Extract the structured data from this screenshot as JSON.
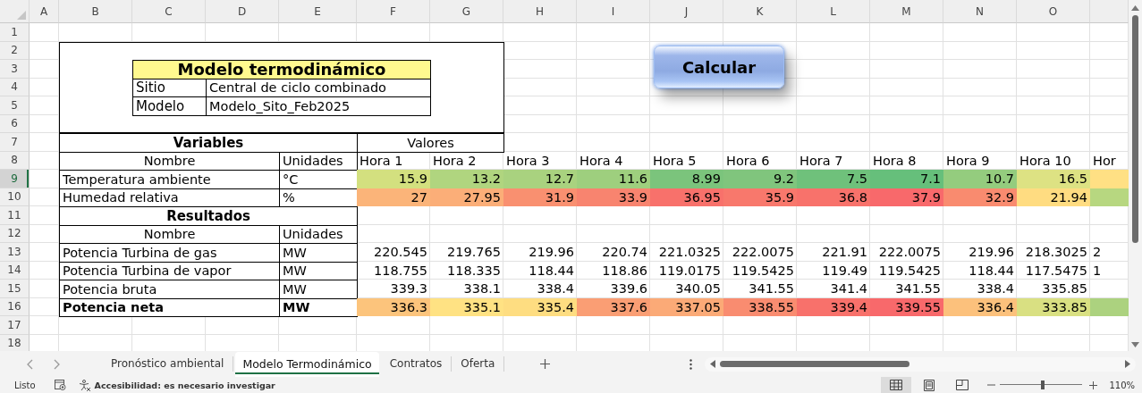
{
  "column_headers": [
    "A",
    "B",
    "C",
    "D",
    "E",
    "F",
    "G",
    "H",
    "I",
    "J",
    "K",
    "L",
    "M",
    "N",
    "O"
  ],
  "row_headers": [
    {
      "label": "1",
      "selected": false
    },
    {
      "label": "2",
      "selected": false
    },
    {
      "label": "3",
      "selected": false
    },
    {
      "label": "4",
      "selected": false
    },
    {
      "label": "5",
      "selected": false
    },
    {
      "label": "6",
      "selected": false
    },
    {
      "label": "7",
      "selected": false
    },
    {
      "label": "8",
      "selected": false
    },
    {
      "label": "9",
      "selected": true
    },
    {
      "label": "10",
      "selected": false
    },
    {
      "label": "11",
      "selected": false
    },
    {
      "label": "12",
      "selected": false
    },
    {
      "label": "13",
      "selected": false
    },
    {
      "label": "14",
      "selected": false
    },
    {
      "label": "15",
      "selected": false
    },
    {
      "label": "16",
      "selected": false
    },
    {
      "label": "17",
      "selected": false
    },
    {
      "label": "18",
      "selected": false
    }
  ],
  "info_box": {
    "title": "Modelo termodinámico",
    "fields": [
      {
        "label": "Sitio",
        "value": "Central de ciclo combinado"
      },
      {
        "label": "Modelo",
        "value": "Modelo_Sito_Feb2025"
      }
    ]
  },
  "button": {
    "label": "Calcular"
  },
  "variables": {
    "heading": "Variables",
    "values_heading": "Valores",
    "name_heading": "Nombre",
    "units_heading": "Unidades",
    "hours": [
      "Hora 1",
      "Hora 2",
      "Hora 3",
      "Hora 4",
      "Hora 5",
      "Hora 6",
      "Hora 7",
      "Hora 8",
      "Hora 9",
      "Hora 10",
      "Hor"
    ],
    "rows": [
      {
        "name": "Temperatura ambiente",
        "unit": "°C",
        "cells": [
          {
            "value": "15.9",
            "color": "#d3e07f"
          },
          {
            "value": "13.2",
            "color": "#b0d57f"
          },
          {
            "value": "12.7",
            "color": "#a9d27f"
          },
          {
            "value": "11.6",
            "color": "#9ecf7e"
          },
          {
            "value": "8.99",
            "color": "#7bc47c"
          },
          {
            "value": "9.2",
            "color": "#80c57d"
          },
          {
            "value": "7.5",
            "color": "#6fc17b"
          },
          {
            "value": "7.1",
            "color": "#66bf7b"
          },
          {
            "value": "10.7",
            "color": "#94cc7e"
          },
          {
            "value": "16.5",
            "color": "#dde283"
          },
          {
            "color": "#ffe084"
          }
        ]
      },
      {
        "name": "Humedad relativa",
        "unit": "%",
        "cells": [
          {
            "value": "27",
            "color": "#fbb479"
          },
          {
            "value": "27.95",
            "color": "#fbae78"
          },
          {
            "value": "31.9",
            "color": "#f99070"
          },
          {
            "value": "33.9",
            "color": "#f8846f"
          },
          {
            "value": "36.95",
            "color": "#f8716b"
          },
          {
            "value": "35.9",
            "color": "#f8786c"
          },
          {
            "value": "36.8",
            "color": "#f8726b"
          },
          {
            "value": "37.9",
            "color": "#f8696b"
          },
          {
            "value": "32.9",
            "color": "#f98b6f"
          },
          {
            "value": "21.94",
            "color": "#ffdc81"
          },
          {
            "color": "#b7d780"
          }
        ]
      }
    ]
  },
  "results": {
    "heading": "Resultados",
    "name_heading": "Nombre",
    "units_heading": "Unidades",
    "rows": [
      {
        "name": "Potencia Turbina de gas",
        "unit": "MW",
        "bold": false,
        "cells": [
          {
            "value": "220.545"
          },
          {
            "value": "219.765"
          },
          {
            "value": "219.96"
          },
          {
            "value": "220.74"
          },
          {
            "value": "221.0325"
          },
          {
            "value": "222.0075"
          },
          {
            "value": "221.91"
          },
          {
            "value": "222.0075"
          },
          {
            "value": "219.96"
          },
          {
            "value": "218.3025"
          },
          {
            "value": "2"
          }
        ]
      },
      {
        "name": "Potencia Turbina de vapor",
        "unit": "MW",
        "bold": false,
        "cells": [
          {
            "value": "118.755"
          },
          {
            "value": "118.335"
          },
          {
            "value": "118.44"
          },
          {
            "value": "118.86"
          },
          {
            "value": "119.0175"
          },
          {
            "value": "119.5425"
          },
          {
            "value": "119.49"
          },
          {
            "value": "119.5425"
          },
          {
            "value": "118.44"
          },
          {
            "value": "117.5475"
          },
          {
            "value": "1"
          }
        ]
      },
      {
        "name": "Potencia bruta",
        "unit": "MW",
        "bold": false,
        "cells": [
          {
            "value": "339.3"
          },
          {
            "value": "338.1"
          },
          {
            "value": "338.4"
          },
          {
            "value": "339.6"
          },
          {
            "value": "340.05"
          },
          {
            "value": "341.55"
          },
          {
            "value": "341.4"
          },
          {
            "value": "341.55"
          },
          {
            "value": "338.4"
          },
          {
            "value": "335.85"
          }
        ]
      },
      {
        "name": "Potencia neta",
        "unit": "MW",
        "bold": true,
        "cells": [
          {
            "value": "336.3",
            "color": "#fcc47c"
          },
          {
            "value": "335.1",
            "color": "#ffe283"
          },
          {
            "value": "335.4",
            "color": "#fedd81"
          },
          {
            "value": "337.6",
            "color": "#fa9e74"
          },
          {
            "value": "337.05",
            "color": "#fbaa77"
          },
          {
            "value": "338.55",
            "color": "#f98c70"
          },
          {
            "value": "339.4",
            "color": "#f8716b"
          },
          {
            "value": "339.55",
            "color": "#f8696b"
          },
          {
            "value": "336.4",
            "color": "#fcc17c"
          },
          {
            "value": "333.85",
            "color": "#d9e082"
          },
          {
            "color": "#acd27f"
          }
        ]
      }
    ]
  },
  "sheet_tabs": [
    {
      "label": "Pronóstico ambiental",
      "selected": false
    },
    {
      "label": "Modelo Termodinámico",
      "selected": true
    },
    {
      "label": "Contratos",
      "selected": false
    },
    {
      "label": "Oferta",
      "selected": false
    }
  ],
  "status_bar": {
    "ready": "Listo",
    "accessibility": "Accesibilidad: es necesario investigar",
    "views": [
      {
        "kind": "normal",
        "selected": true
      },
      {
        "kind": "page_layout",
        "selected": false
      },
      {
        "kind": "page_break",
        "selected": false
      }
    ],
    "zoom": {
      "level": 0.52,
      "reading": "110%"
    }
  }
}
